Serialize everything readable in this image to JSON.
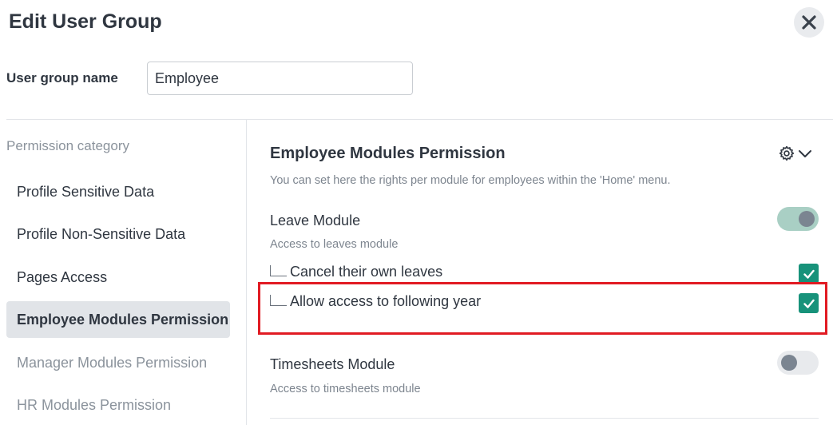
{
  "dialog": {
    "title": "Edit User Group"
  },
  "form": {
    "name_label": "User group name",
    "name_value": "Employee"
  },
  "sidebar": {
    "heading": "Permission category",
    "items": [
      {
        "label": "Profile Sensitive Data",
        "state": "normal"
      },
      {
        "label": "Profile Non-Sensitive Data",
        "state": "normal"
      },
      {
        "label": "Pages Access",
        "state": "normal"
      },
      {
        "label": "Employee Modules Permission",
        "state": "active"
      },
      {
        "label": "Manager Modules Permission",
        "state": "muted"
      },
      {
        "label": "HR Modules Permission",
        "state": "muted"
      }
    ]
  },
  "section": {
    "title": "Employee Modules Permission",
    "description": "You can set here the rights per module for employees within the 'Home' menu.",
    "modules": [
      {
        "title": "Leave Module",
        "description": "Access to leaves module",
        "enabled": true,
        "sub_permissions": [
          {
            "label": "Cancel their own leaves",
            "checked": true
          },
          {
            "label": "Allow access to following year",
            "checked": true,
            "highlighted": true
          }
        ]
      },
      {
        "title": "Timesheets Module",
        "description": "Access to timesheets module",
        "enabled": false
      }
    ]
  },
  "icons": {
    "close": "close-icon",
    "settings": "gear-icon",
    "expand": "chevron-down-icon",
    "check": "check-icon"
  },
  "colors": {
    "accent_green": "#17927a",
    "switch_on_track": "#a9cfc4",
    "switch_off_track": "#e8eaed",
    "active_category_bg": "#e1e4e8",
    "highlight_border": "#e11b23"
  }
}
